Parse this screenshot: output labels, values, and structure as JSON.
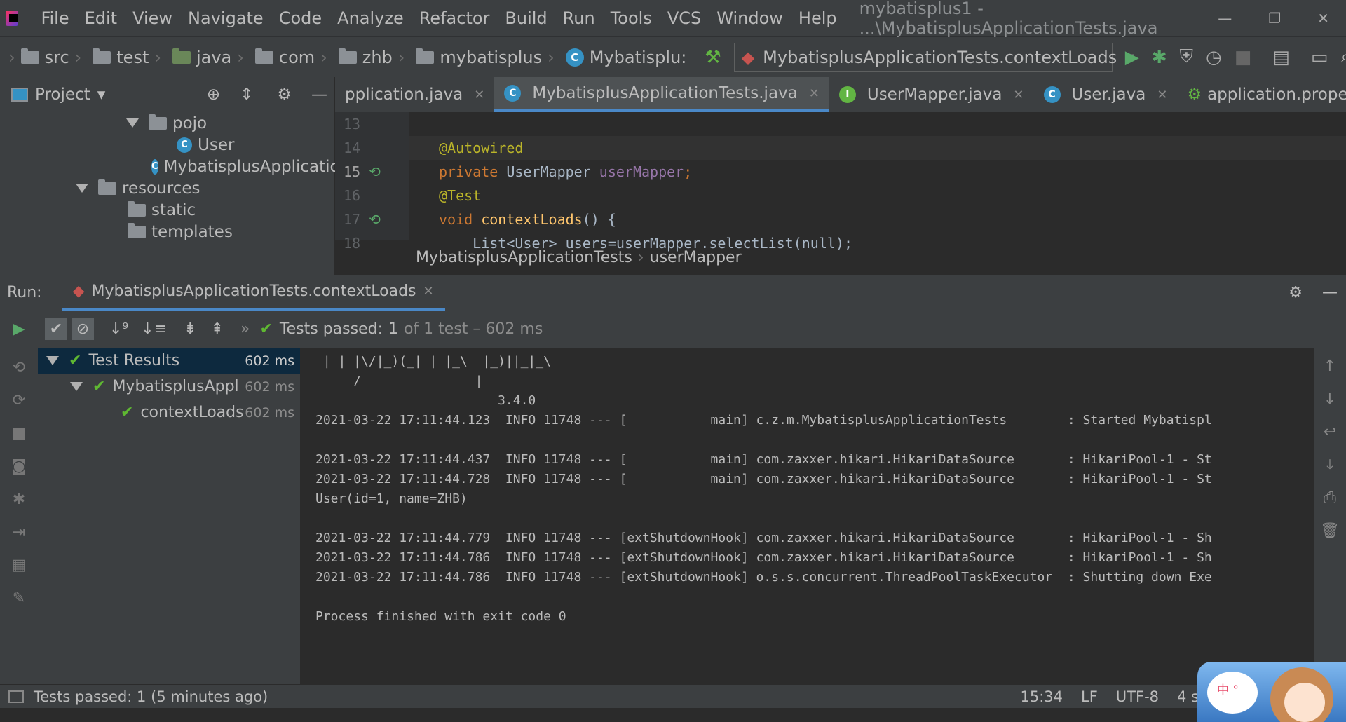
{
  "menubar": {
    "items": [
      "File",
      "Edit",
      "View",
      "Navigate",
      "Code",
      "Analyze",
      "Refactor",
      "Build",
      "Run",
      "Tools",
      "VCS",
      "Window",
      "Help"
    ],
    "title": "mybatisplus1 - ...\\MybatisplusApplicationTests.java"
  },
  "navbar": {
    "crumbs": [
      "src",
      "test",
      "java",
      "com",
      "zhb",
      "mybatisplus",
      "Mybatisplu:"
    ],
    "run_config": "MybatisplusApplicationTests.contextLoads"
  },
  "project": {
    "header": "Project",
    "tree": [
      {
        "label": "pojo",
        "icon": "folder-icon"
      },
      {
        "label": "User",
        "icon": "class-icon"
      },
      {
        "label": "MybatisplusApplicatic",
        "icon": "class-icon"
      },
      {
        "label": "resources",
        "icon": "folder-icon"
      },
      {
        "label": "static",
        "icon": "folder-icon"
      },
      {
        "label": "templates",
        "icon": "folder-icon"
      }
    ]
  },
  "tabs": [
    {
      "label": "pplication.java"
    },
    {
      "label": "MybatisplusApplicationTests.java",
      "active": true
    },
    {
      "label": "UserMapper.java"
    },
    {
      "label": "User.java"
    },
    {
      "label": "application.properties"
    }
  ],
  "code": {
    "line_numbers": [
      "13",
      "14",
      "15",
      "16",
      "17",
      "18"
    ],
    "lines": [
      "",
      "@Autowired",
      "private UserMapper userMapper;",
      "@Test",
      "void contextLoads() {",
      "    List<User> users=userMapper.selectList(null);"
    ]
  },
  "editor_breadcrumb": [
    "MybatisplusApplicationTests",
    "userMapper"
  ],
  "run": {
    "label": "Run:",
    "tab": "MybatisplusApplicationTests.contextLoads",
    "passed": "Tests passed:",
    "passed_count": "1",
    "passed_tail": "of 1 test – 602 ms",
    "results": [
      {
        "label": "Test Results",
        "time": "602 ms"
      },
      {
        "label": "MybatisplusAppl",
        "time": "602 ms"
      },
      {
        "label": "contextLoads",
        "time": "602 ms"
      }
    ]
  },
  "console": [
    " | | |\\/|_)(_| | |_\\  |_)||_|_\\",
    "     /               |",
    "                        3.4.0",
    "2021-03-22 17:11:44.123  INFO 11748 --- [           main] c.z.m.MybatisplusApplicationTests        : Started Mybatispl",
    "",
    "2021-03-22 17:11:44.437  INFO 11748 --- [           main] com.zaxxer.hikari.HikariDataSource       : HikariPool-1 - St",
    "2021-03-22 17:11:44.728  INFO 11748 --- [           main] com.zaxxer.hikari.HikariDataSource       : HikariPool-1 - St",
    "User(id=1, name=ZHB)",
    "",
    "2021-03-22 17:11:44.779  INFO 11748 --- [extShutdownHook] com.zaxxer.hikari.HikariDataSource       : HikariPool-1 - Sh",
    "2021-03-22 17:11:44.786  INFO 11748 --- [extShutdownHook] com.zaxxer.hikari.HikariDataSource       : HikariPool-1 - Sh",
    "2021-03-22 17:11:44.786  INFO 11748 --- [extShutdownHook] o.s.s.concurrent.ThreadPoolTaskExecutor  : Shutting down Exe",
    "",
    "Process finished with exit code 0"
  ],
  "status": {
    "message": "Tests passed: 1 (5 minutes ago)",
    "position": "15:34",
    "line_sep": "LF",
    "encoding": "UTF-8",
    "indent": "4 s"
  },
  "mascot_text": "中 °"
}
